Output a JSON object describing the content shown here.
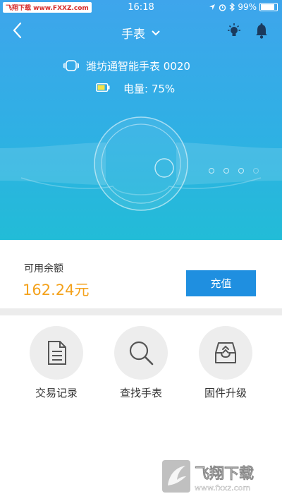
{
  "status_bar": {
    "watermark": "飞翔下载 www.FXXZ.com",
    "time": "16:18",
    "battery_percent": "99%"
  },
  "nav": {
    "title": "手表"
  },
  "device": {
    "name": "潍坊通智能手表 0020",
    "battery_label": "电量: 75%"
  },
  "balance": {
    "label": "可用余额",
    "value": "162.24元",
    "recharge_label": "充值"
  },
  "actions": [
    {
      "label": "交易记录",
      "icon": "document-icon"
    },
    {
      "label": "查找手表",
      "icon": "search-icon"
    },
    {
      "label": "固件升级",
      "icon": "upgrade-tray-icon"
    }
  ],
  "watermark_logo": {
    "brand": "飞翔下载",
    "url": "www.fxxz.com"
  },
  "colors": {
    "header_blue": "#3ea5ec",
    "header_teal": "#22bcd7",
    "balance_orange": "#f4a21c",
    "button_blue": "#1f8fe0"
  }
}
